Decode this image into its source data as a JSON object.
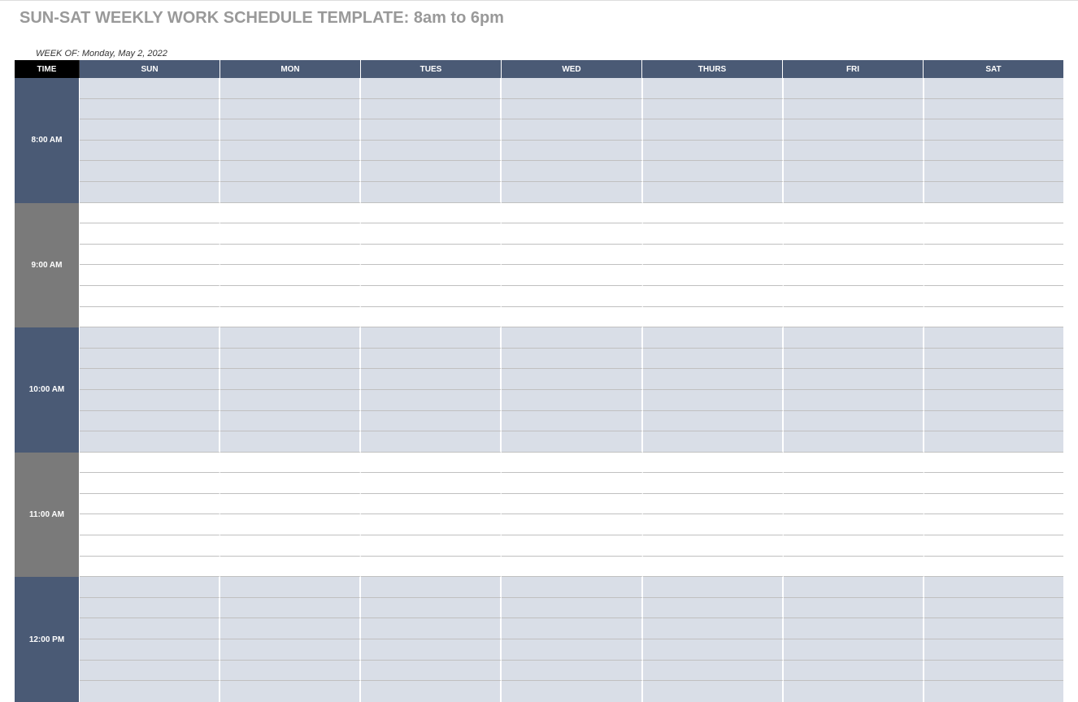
{
  "title": "SUN-SAT WEEKLY WORK SCHEDULE TEMPLATE: 8am to 6pm",
  "week_of_label": "WEEK OF:",
  "week_of_value": "Monday, May 2, 2022",
  "headers": {
    "time": "TIME",
    "days": [
      "SUN",
      "MON",
      "TUES",
      "WED",
      "THURS",
      "FRI",
      "SAT"
    ]
  },
  "hours": [
    {
      "label": "8:00 AM",
      "style": "dark",
      "shaded": true
    },
    {
      "label": "9:00 AM",
      "style": "light",
      "shaded": false
    },
    {
      "label": "10:00 AM",
      "style": "dark",
      "shaded": true
    },
    {
      "label": "11:00 AM",
      "style": "light",
      "shaded": false
    },
    {
      "label": "12:00 PM",
      "style": "dark",
      "shaded": true
    }
  ],
  "slots_per_hour": 6,
  "colors": {
    "header_dark": "#4a5a75",
    "header_time": "#000000",
    "hour_light": "#7a7a7a",
    "cell_shaded": "#d9dee7"
  }
}
